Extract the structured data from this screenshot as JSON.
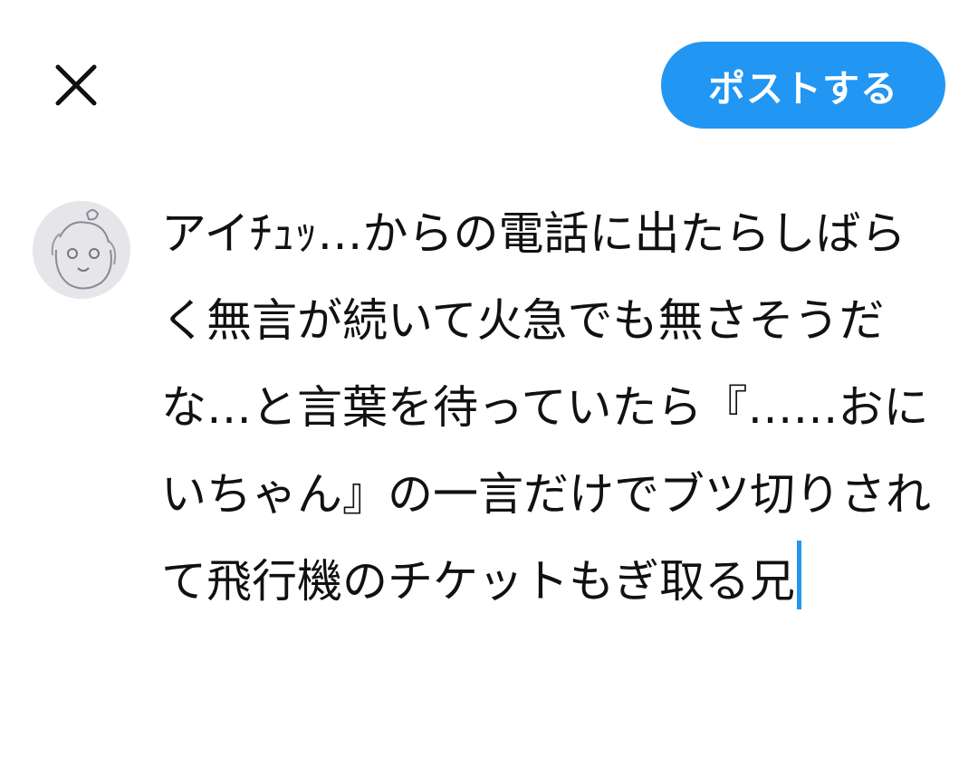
{
  "header": {
    "close_icon": "close-icon",
    "post_label": "ポストする",
    "accent_color": "#2196f3"
  },
  "composer": {
    "avatar_icon": "user-avatar",
    "text": "アイﾁｭｯ…からの電話に出たらしばらく無言が続いて火急でも無さそうだな…と言葉を待っていたら『……おにいちゃん』の一言だけでブツ切りされて飛行機のチケットもぎ取る兄"
  }
}
